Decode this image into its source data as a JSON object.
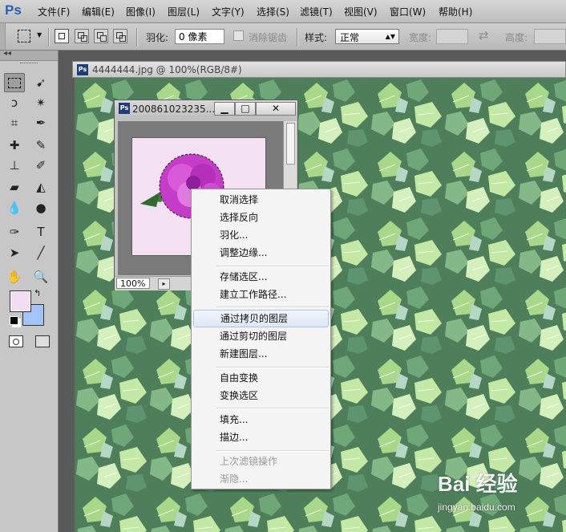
{
  "app": {
    "logo": "Ps"
  },
  "menubar": {
    "items": [
      "文件(F)",
      "编辑(E)",
      "图像(I)",
      "图层(L)",
      "文字(Y)",
      "选择(S)",
      "滤镜(T)",
      "视图(V)",
      "窗口(W)",
      "帮助(H)"
    ]
  },
  "options": {
    "feather_label": "羽化:",
    "feather_value": "0 像素",
    "antialias_label": "消除锯齿",
    "style_label": "样式:",
    "style_value": "正常",
    "width_label": "宽度:",
    "height_label": "高度:"
  },
  "tools": {
    "grip": "◂◂",
    "icons": [
      "marquee-tool",
      "move-tool",
      "lasso-tool",
      "magic-wand-tool",
      "crop-tool",
      "eyedropper-tool",
      "healing-brush-tool",
      "brush-tool",
      "clone-stamp-tool",
      "history-brush-tool",
      "eraser-tool",
      "paint-bucket-tool",
      "blur-tool",
      "dodge-tool",
      "pen-tool",
      "type-tool",
      "path-selection-tool",
      "line-tool",
      "hand-tool",
      "zoom-tool"
    ],
    "fg_color": "#f3ddf3",
    "bg_color": "#a4c4f8"
  },
  "document": {
    "title": "4444444.jpg @ 100%(RGB/8#)"
  },
  "subdoc": {
    "title": "200861023235...",
    "zoom": "100%",
    "bg_color": "#f3e0f3"
  },
  "context_menu": {
    "items": [
      {
        "label": "取消选择",
        "state": "normal"
      },
      {
        "label": "选择反向",
        "state": "normal"
      },
      {
        "label": "羽化...",
        "state": "normal"
      },
      {
        "label": "调整边缘...",
        "state": "normal"
      },
      {
        "label": "存储选区...",
        "state": "normal"
      },
      {
        "label": "建立工作路径...",
        "state": "normal"
      },
      {
        "label": "通过拷贝的图层",
        "state": "hover"
      },
      {
        "label": "通过剪切的图层",
        "state": "normal"
      },
      {
        "label": "新建图层...",
        "state": "normal"
      },
      {
        "label": "自由变换",
        "state": "normal"
      },
      {
        "label": "变换选区",
        "state": "normal"
      },
      {
        "label": "填充...",
        "state": "normal"
      },
      {
        "label": "描边...",
        "state": "normal"
      },
      {
        "label": "上次滤镜操作",
        "state": "disabled"
      },
      {
        "label": "渐隐...",
        "state": "disabled"
      }
    ]
  },
  "watermark": {
    "logo": "Bai 经验",
    "url": "jingyan.baidu.com"
  }
}
